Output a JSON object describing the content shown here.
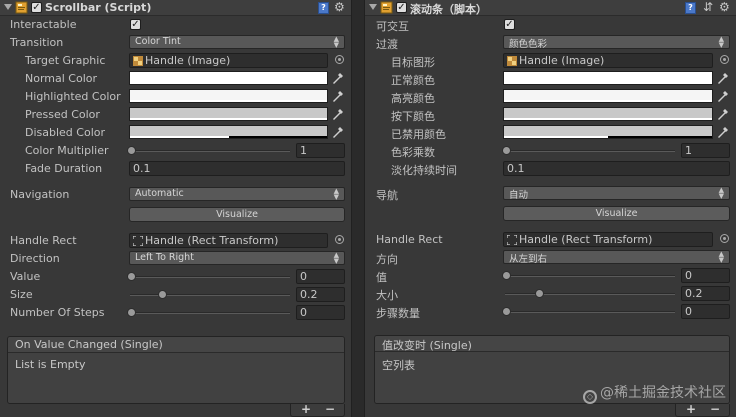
{
  "left": {
    "header": {
      "title": "Scrollbar (Script)"
    },
    "interactable": {
      "label": "Interactable",
      "checked": "✓"
    },
    "transition": {
      "label": "Transition",
      "value": "Color Tint"
    },
    "target_graphic": {
      "label": "Target Graphic",
      "value": "Handle (Image)"
    },
    "normal_color": {
      "label": "Normal Color",
      "color": "#ffffff"
    },
    "highlighted_color": {
      "label": "Highlighted Color",
      "color": "#f5f5f5"
    },
    "pressed_color": {
      "label": "Pressed Color",
      "color": "#c8c8c8"
    },
    "disabled_color": {
      "label": "Disabled Color",
      "color": "#c8c8c8",
      "alpha": 0.5
    },
    "color_multiplier": {
      "label": "Color Multiplier",
      "value": "1"
    },
    "fade_duration": {
      "label": "Fade Duration",
      "value": "0.1"
    },
    "navigation": {
      "label": "Navigation",
      "value": "Automatic"
    },
    "visualize": {
      "label": "Visualize"
    },
    "handle_rect": {
      "label": "Handle Rect",
      "value": "Handle (Rect Transform)"
    },
    "direction": {
      "label": "Direction",
      "value": "Left To Right"
    },
    "value": {
      "label": "Value",
      "value": "0"
    },
    "size": {
      "label": "Size",
      "value": "0.2"
    },
    "steps": {
      "label": "Number Of Steps",
      "value": "0"
    },
    "event": {
      "title": "On Value Changed (Single)",
      "empty": "List is Empty"
    }
  },
  "right": {
    "header": {
      "title": "滚动条（脚本）"
    },
    "interactable": {
      "label": "可交互",
      "checked": "✓"
    },
    "transition": {
      "label": "过渡",
      "value": "颜色色彩"
    },
    "target_graphic": {
      "label": "目标图形",
      "value": "Handle (Image)"
    },
    "normal_color": {
      "label": "正常颜色",
      "color": "#ffffff"
    },
    "highlighted_color": {
      "label": "高亮颜色",
      "color": "#f5f5f5"
    },
    "pressed_color": {
      "label": "按下颜色",
      "color": "#c8c8c8"
    },
    "disabled_color": {
      "label": "已禁用颜色",
      "color": "#c8c8c8",
      "alpha": 0.5
    },
    "color_multiplier": {
      "label": "色彩乘数",
      "value": "1"
    },
    "fade_duration": {
      "label": "淡化持续时间",
      "value": "0.1"
    },
    "navigation": {
      "label": "导航",
      "value": "自动"
    },
    "visualize": {
      "label": "Visualize"
    },
    "handle_rect": {
      "label": "Handle Rect",
      "value": "Handle (Rect Transform)"
    },
    "direction": {
      "label": "方向",
      "value": "从左到右"
    },
    "value": {
      "label": "值",
      "value": "0"
    },
    "size": {
      "label": "大小",
      "value": "0.2"
    },
    "steps": {
      "label": "步骤数量",
      "value": "0"
    },
    "event": {
      "title": "值改变时 (Single)",
      "empty": "空列表"
    }
  },
  "footer": {
    "plus": "+",
    "minus": "−"
  },
  "watermark": {
    "text": "@稀土掘金技术社区"
  }
}
